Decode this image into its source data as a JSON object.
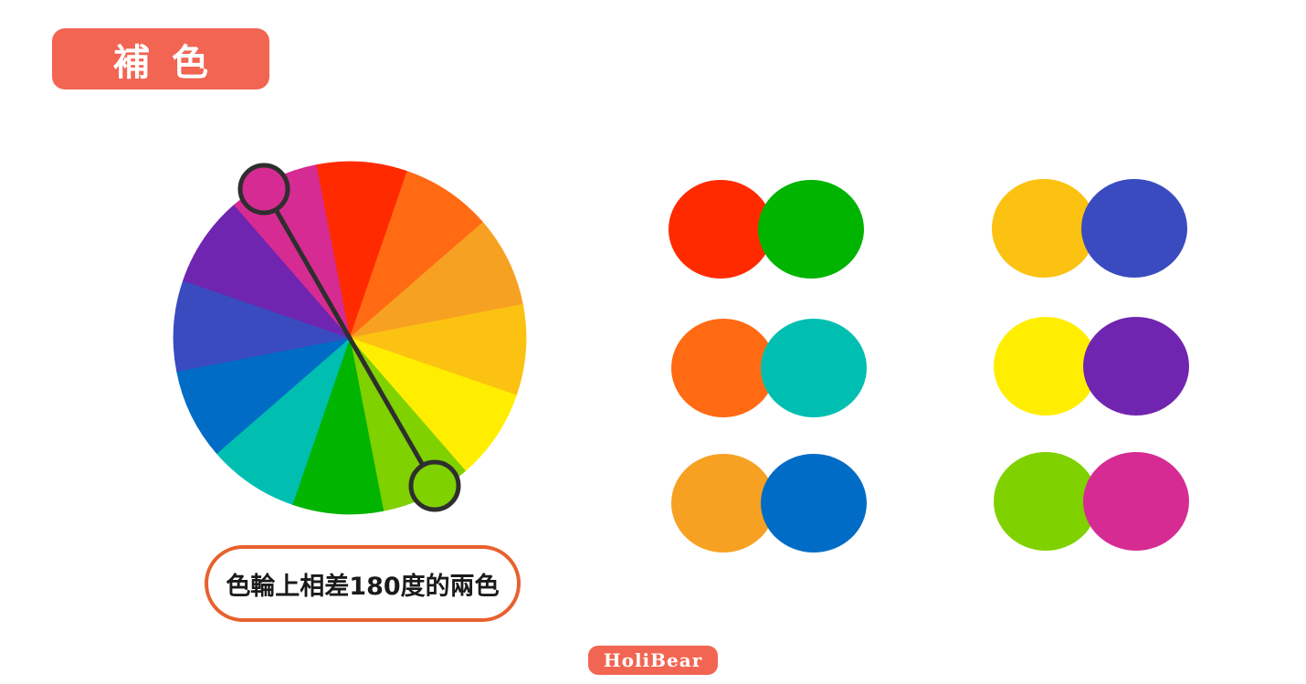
{
  "title": "補色",
  "caption": "色輪上相差180度的兩色",
  "logo": "HoliBear",
  "colors": {
    "accent": "#F26552",
    "caption_border": "#E8612E",
    "marker_stroke": "#2E2E2E",
    "white": "#FFFFFF"
  },
  "color_wheel": {
    "segments": [
      "#FF2A00",
      "#FF6A13",
      "#F7A122",
      "#FCC212",
      "#FFEE00",
      "#7FD100",
      "#00B400",
      "#00BFB0",
      "#006CC5",
      "#3A4BBF",
      "#7025B0",
      "#D62B93"
    ],
    "markers": [
      {
        "name": "magenta-marker",
        "color": "#D62B93"
      },
      {
        "name": "yellow-green-marker",
        "color": "#7FD100"
      }
    ]
  },
  "complementary_pairs": [
    {
      "left": "#FF2A00",
      "right": "#00B400"
    },
    {
      "left": "#FF6A13",
      "right": "#00BFB0"
    },
    {
      "left": "#F7A122",
      "right": "#006CC5"
    },
    {
      "left": "#FCC212",
      "right": "#3A4BBF"
    },
    {
      "left": "#FFEE00",
      "right": "#7025B0"
    },
    {
      "left": "#7FD100",
      "right": "#D62B93"
    }
  ]
}
